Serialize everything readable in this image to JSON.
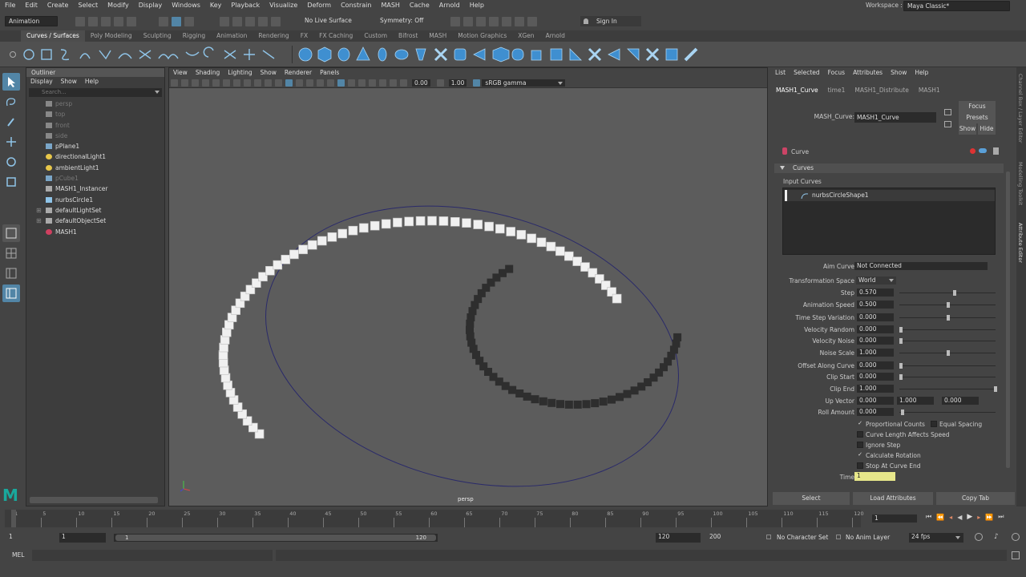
{
  "menubar": {
    "items": [
      "File",
      "Edit",
      "Create",
      "Select",
      "Modify",
      "Display",
      "Windows",
      "Key",
      "Playback",
      "Visualize",
      "Deform",
      "Constrain",
      "MASH",
      "Cache",
      "Arnold",
      "Help"
    ],
    "workspace_label": "Workspace :",
    "workspace_value": "Maya Classic*"
  },
  "statusline": {
    "menuset": "Animation",
    "live_surface": "No Live Surface",
    "symmetry": "Symmetry: Off",
    "sign_in": "Sign In"
  },
  "shelf_tabs": [
    "Curves / Surfaces",
    "Poly Modeling",
    "Sculpting",
    "Rigging",
    "Animation",
    "Rendering",
    "FX",
    "FX Caching",
    "Custom",
    "Bifrost",
    "MASH",
    "Motion Graphics",
    "XGen",
    "Arnold"
  ],
  "shelf_active": "Curves / Surfaces",
  "outliner": {
    "title": "Outliner",
    "menu": [
      "Display",
      "Show",
      "Help"
    ],
    "search_placeholder": "Search...",
    "items": [
      {
        "label": "persp",
        "dim": true,
        "icon": "camera-icon"
      },
      {
        "label": "top",
        "dim": true,
        "icon": "camera-icon"
      },
      {
        "label": "front",
        "dim": true,
        "icon": "camera-icon"
      },
      {
        "label": "side",
        "dim": true,
        "icon": "camera-icon"
      },
      {
        "label": "pPlane1",
        "dim": false,
        "icon": "mesh-icon"
      },
      {
        "label": "directionalLight1",
        "dim": false,
        "icon": "light-icon"
      },
      {
        "label": "ambientLight1",
        "dim": false,
        "icon": "light-icon"
      },
      {
        "label": "pCube1",
        "dim": true,
        "icon": "mesh-icon"
      },
      {
        "label": "MASH1_Instancer",
        "dim": false,
        "icon": "instancer-icon"
      },
      {
        "label": "nurbsCircle1",
        "dim": false,
        "icon": "curve-icon"
      },
      {
        "label": "defaultLightSet",
        "dim": false,
        "icon": "set-icon"
      },
      {
        "label": "defaultObjectSet",
        "dim": false,
        "icon": "set-icon"
      },
      {
        "label": "MASH1",
        "dim": false,
        "icon": "mash-icon"
      }
    ]
  },
  "viewport": {
    "menu": [
      "View",
      "Shading",
      "Lighting",
      "Show",
      "Renderer",
      "Panels"
    ],
    "near": "0.00",
    "far": "1.00",
    "color_space": "sRGB gamma",
    "camera": "persp"
  },
  "attribute_editor": {
    "menu": [
      "List",
      "Selected",
      "Focus",
      "Attributes",
      "Show",
      "Help"
    ],
    "tabs": [
      "MASH1_Curve",
      "time1",
      "MASH1_Distribute",
      "MASH1"
    ],
    "node_label": "MASH_Curve:",
    "node_value": "MASH1_Curve",
    "focus": "Focus",
    "presets": "Presets",
    "show": "Show",
    "hide": "Hide",
    "section": "Curve",
    "subsection": "Curves",
    "input_curves_label": "Input Curves",
    "input_curve_item": "nurbsCircleShape1",
    "aim_curve_label": "Aim Curve",
    "aim_curve_value": "Not Connected",
    "transformation_space_label": "Transformation Space",
    "transformation_space_value": "World",
    "attrs": [
      {
        "label": "Step",
        "value": "0.570",
        "slider": 0.57
      },
      {
        "label": "Animation Speed",
        "value": "0.500",
        "slider": 0.5
      },
      {
        "label": "Time Step Variation",
        "value": "0.000",
        "slider": 0.5
      },
      {
        "label": "Velocity Random",
        "value": "0.000",
        "slider": 0.0
      },
      {
        "label": "Velocity Noise",
        "value": "0.000",
        "slider": 0.0
      },
      {
        "label": "Noise Scale",
        "value": "1.000",
        "slider": 0.5
      },
      {
        "label": "Offset Along Curve",
        "value": "0.000",
        "slider": 0.0
      },
      {
        "label": "Clip Start",
        "value": "0.000",
        "slider": 0.0
      },
      {
        "label": "Clip End",
        "value": "1.000",
        "slider": 1.0
      }
    ],
    "up_vector_label": "Up Vector",
    "up_vector": [
      "0.000",
      "1.000",
      "0.000"
    ],
    "roll_amount_label": "Roll Amount",
    "roll_amount_value": "0.000",
    "checks": [
      {
        "label": "Proportional Counts",
        "checked": true
      },
      {
        "label": "Equal Spacing",
        "checked": false
      },
      {
        "label": "Curve Length Affects Speed",
        "checked": false
      },
      {
        "label": "Ignore Step",
        "checked": false
      },
      {
        "label": "Calculate Rotation",
        "checked": true
      },
      {
        "label": "Stop At Curve End",
        "checked": false
      }
    ],
    "time_label": "Time",
    "time_value": "1",
    "buttons": [
      "Select",
      "Load Attributes",
      "Copy Tab"
    ]
  },
  "side_tabs": [
    "Channel Box / Layer Editor",
    "Modelling Toolkit",
    "Attribute Editor"
  ],
  "timeline": {
    "ticks": [
      "1",
      "5",
      "10",
      "15",
      "20",
      "25",
      "30",
      "35",
      "40",
      "45",
      "50",
      "55",
      "60",
      "65",
      "70",
      "75",
      "80",
      "85",
      "90",
      "95",
      "100",
      "105",
      "110",
      "115",
      "120"
    ],
    "current_frame": "1"
  },
  "range": {
    "start": "1",
    "playback_start": "1",
    "slider_start": "1",
    "slider_end": "120",
    "playback_end": "120",
    "end": "200",
    "character_set": "No Character Set",
    "anim_layer": "No Anim Layer",
    "fps": "24 fps"
  },
  "cmdline": {
    "label": "MEL"
  }
}
